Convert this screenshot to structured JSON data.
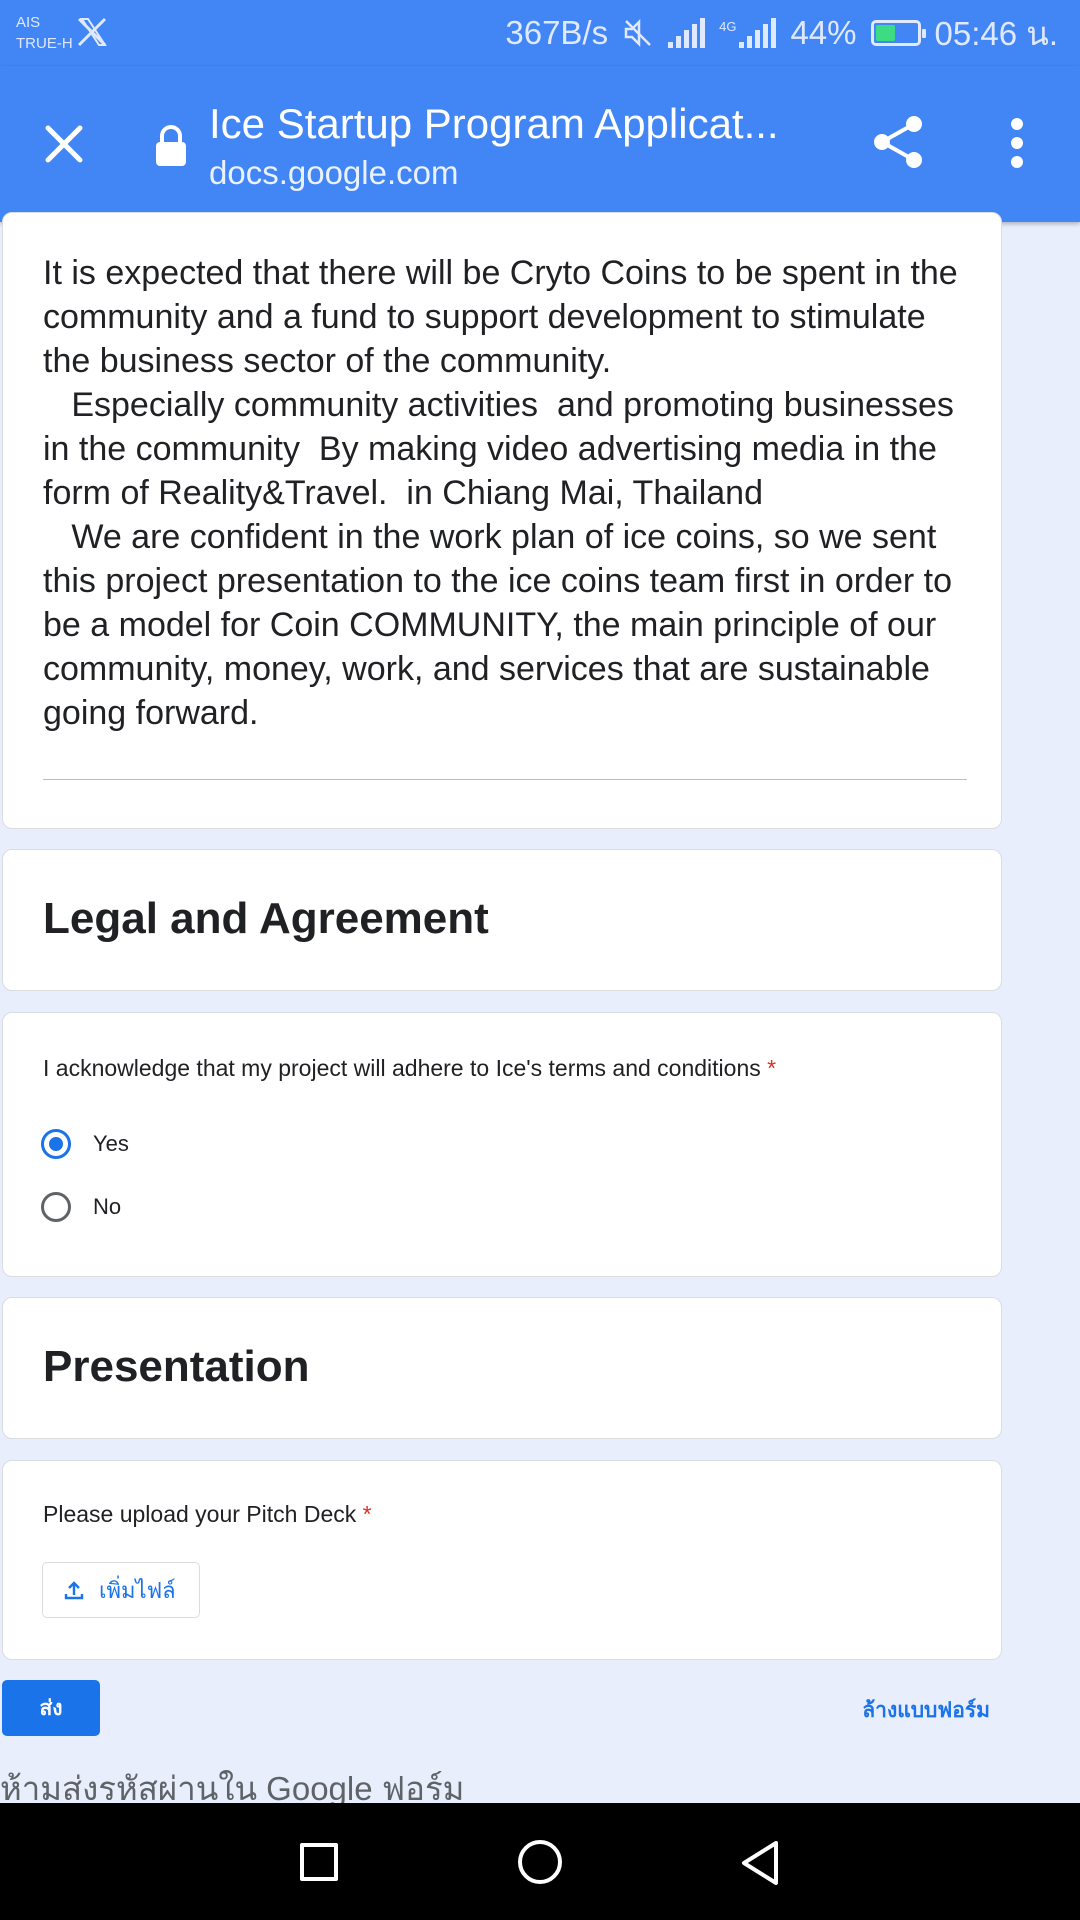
{
  "status_bar": {
    "carrier_line1": "AIS",
    "carrier_line2": "TRUE-H",
    "app_icon": "x-logo-icon",
    "network_speed": "367B/s",
    "network_type": "4G",
    "battery_percent": "44%",
    "battery_level": 0.44,
    "time": "05:46 น."
  },
  "toolbar": {
    "title": "Ice Startup Program Applicat...",
    "url": "docs.google.com",
    "close_icon": "close-icon",
    "lock_icon": "lock-icon",
    "share_icon": "share-icon",
    "menu_icon": "more-vert-icon"
  },
  "description": {
    "text": "It is expected that there will be Cryto Coins to be spent in the community and a fund to support development to stimulate the business sector of the community.\n   Especially community activities  and promoting businesses in the community  By making video advertising media in the form of Reality&Travel.  in Chiang Mai, Thailand\n   We are confident in the work plan of ice coins, so we sent this project presentation to the ice coins team first in order to be a model for Coin COMMUNITY, the main principle of our community, money, work, and services that are sustainable going forward."
  },
  "sections": {
    "legal_title": "Legal and Agreement",
    "presentation_title": "Presentation"
  },
  "agreement_question": {
    "label": "I acknowledge that my project will adhere to Ice's terms and conditions",
    "required_mark": "*",
    "options": [
      "Yes",
      "No"
    ],
    "selected": "Yes"
  },
  "upload_question": {
    "label": "Please upload your Pitch Deck",
    "required_mark": "*",
    "button_label": "เพิ่มไฟล์",
    "button_icon": "upload-icon"
  },
  "form_actions": {
    "submit_label": "ส่ง",
    "clear_label": "ล้างแบบฟอร์ม"
  },
  "footer": {
    "note": "ห้ามส่งรหัสผ่านใน Google ฟอร์ม"
  },
  "colors": {
    "toolbar_blue": "#4285f4",
    "accent_blue": "#1a73e8",
    "background": "#e8eefb",
    "required_red": "#d93025"
  },
  "nav_bar": {
    "recent_icon": "square-recents-icon",
    "home_icon": "circle-home-icon",
    "back_icon": "triangle-back-icon"
  }
}
